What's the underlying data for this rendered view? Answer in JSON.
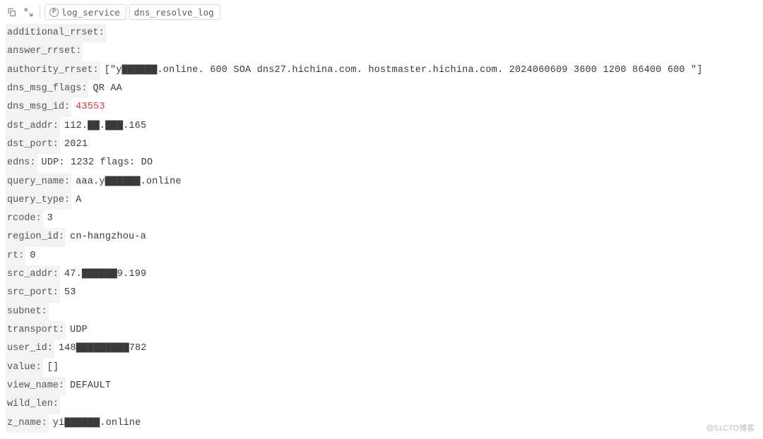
{
  "toolbar": {
    "tags": [
      {
        "icon": "P",
        "label": "log_service"
      },
      {
        "icon": "",
        "label": "dns_resolve_log"
      }
    ]
  },
  "log": {
    "rows": [
      {
        "key": "additional_rrset:",
        "val": "",
        "highlight": false,
        "array": false
      },
      {
        "key": "answer_rrset:",
        "val": "",
        "highlight": false,
        "array": false
      },
      {
        "key": "authority_rrset:",
        "val": "[\"y▇▇▇▇▇▇.online. 600 SOA dns27.hichina.com. hostmaster.hichina.com. 2024060609 3600 1200 86400 600 \"]",
        "highlight": false,
        "array": true
      },
      {
        "key": "dns_msg_flags:",
        "val": "QR AA",
        "highlight": false,
        "array": false
      },
      {
        "key": "dns_msg_id:",
        "val": "43553",
        "highlight": true,
        "array": false
      },
      {
        "key": "dst_addr:",
        "val": "112.▇▇.▇▇▇.165",
        "highlight": false,
        "array": false
      },
      {
        "key": "dst_port:",
        "val": "2021",
        "highlight": false,
        "array": false
      },
      {
        "key": "edns:",
        "val": "UDP: 1232 flags: DO",
        "highlight": false,
        "array": false
      },
      {
        "key": "query_name:",
        "val": "aaa.y▇▇▇▇▇▇.online",
        "highlight": false,
        "array": false
      },
      {
        "key": "query_type:",
        "val": "A",
        "highlight": false,
        "array": false
      },
      {
        "key": "rcode:",
        "val": "3",
        "highlight": false,
        "array": false
      },
      {
        "key": "region_id:",
        "val": "cn-hangzhou-a",
        "highlight": false,
        "array": false
      },
      {
        "key": "rt:",
        "val": "0",
        "highlight": false,
        "array": false
      },
      {
        "key": "src_addr:",
        "val": "47.▇▇▇▇▇▇9.199",
        "highlight": false,
        "array": false
      },
      {
        "key": "src_port:",
        "val": "53",
        "highlight": false,
        "array": false
      },
      {
        "key": "subnet:",
        "val": "",
        "highlight": false,
        "array": false
      },
      {
        "key": "transport:",
        "val": "UDP",
        "highlight": false,
        "array": false
      },
      {
        "key": "user_id:",
        "val": "148▇▇▇▇▇▇▇▇▇782",
        "highlight": false,
        "array": false
      },
      {
        "key": "value:",
        "val": "[]",
        "highlight": false,
        "array": true
      },
      {
        "key": "view_name:",
        "val": "DEFAULT",
        "highlight": false,
        "array": false
      },
      {
        "key": "wild_len:",
        "val": "",
        "highlight": false,
        "array": false
      },
      {
        "key": "z_name:",
        "val": "yi▇▇▇▇▇▇.online",
        "highlight": false,
        "array": false
      }
    ]
  },
  "watermark": "@51CTO博客"
}
